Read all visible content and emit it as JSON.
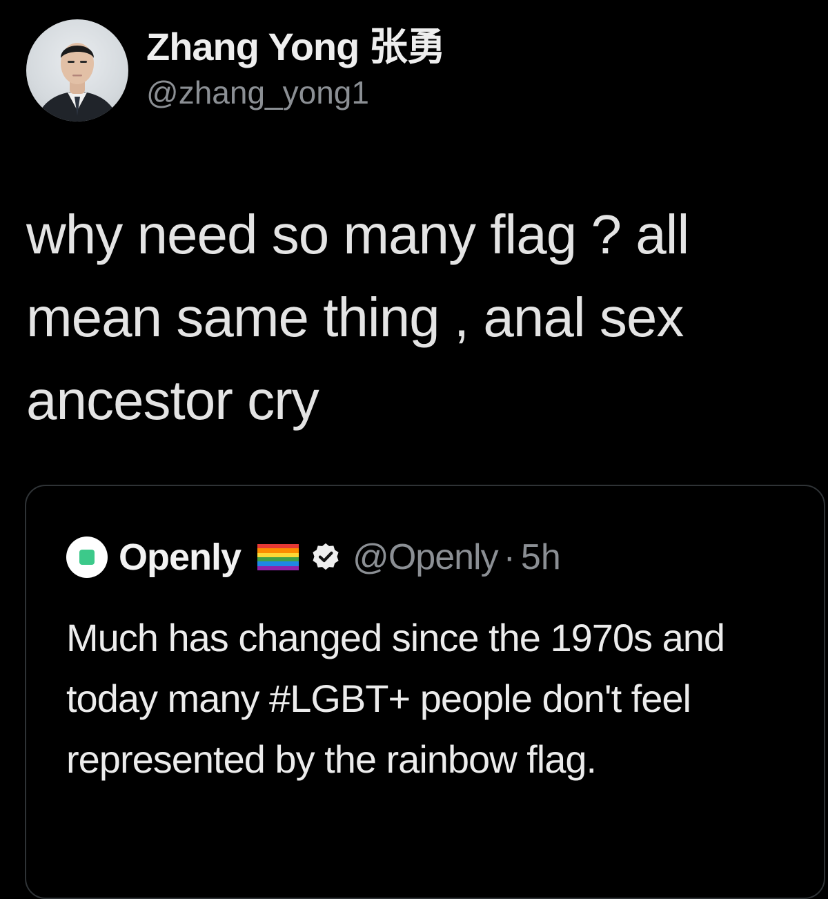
{
  "tweet": {
    "author": {
      "display_name": "Zhang Yong 张勇",
      "handle": "@zhang_yong1",
      "avatar_icon": "profile-photo"
    },
    "text": "why need so many flag ? all mean same thing , anal sex ancestor cry"
  },
  "quoted_tweet": {
    "author": {
      "display_name": "Openly",
      "handle": "@Openly",
      "separator": "·",
      "time": "5h",
      "avatar_icon": "openly-logo-icon",
      "flag_icon": "rainbow-flag-icon",
      "verified_icon": "verified-badge-icon"
    },
    "text": "Much has changed since the 1970s and today many #LGBT+ people don't feel represented by the rainbow flag."
  },
  "colors": {
    "background": "#000000",
    "primary_text": "#e7e9ea",
    "secondary_text": "#8b8f94",
    "border": "#2f3336"
  }
}
